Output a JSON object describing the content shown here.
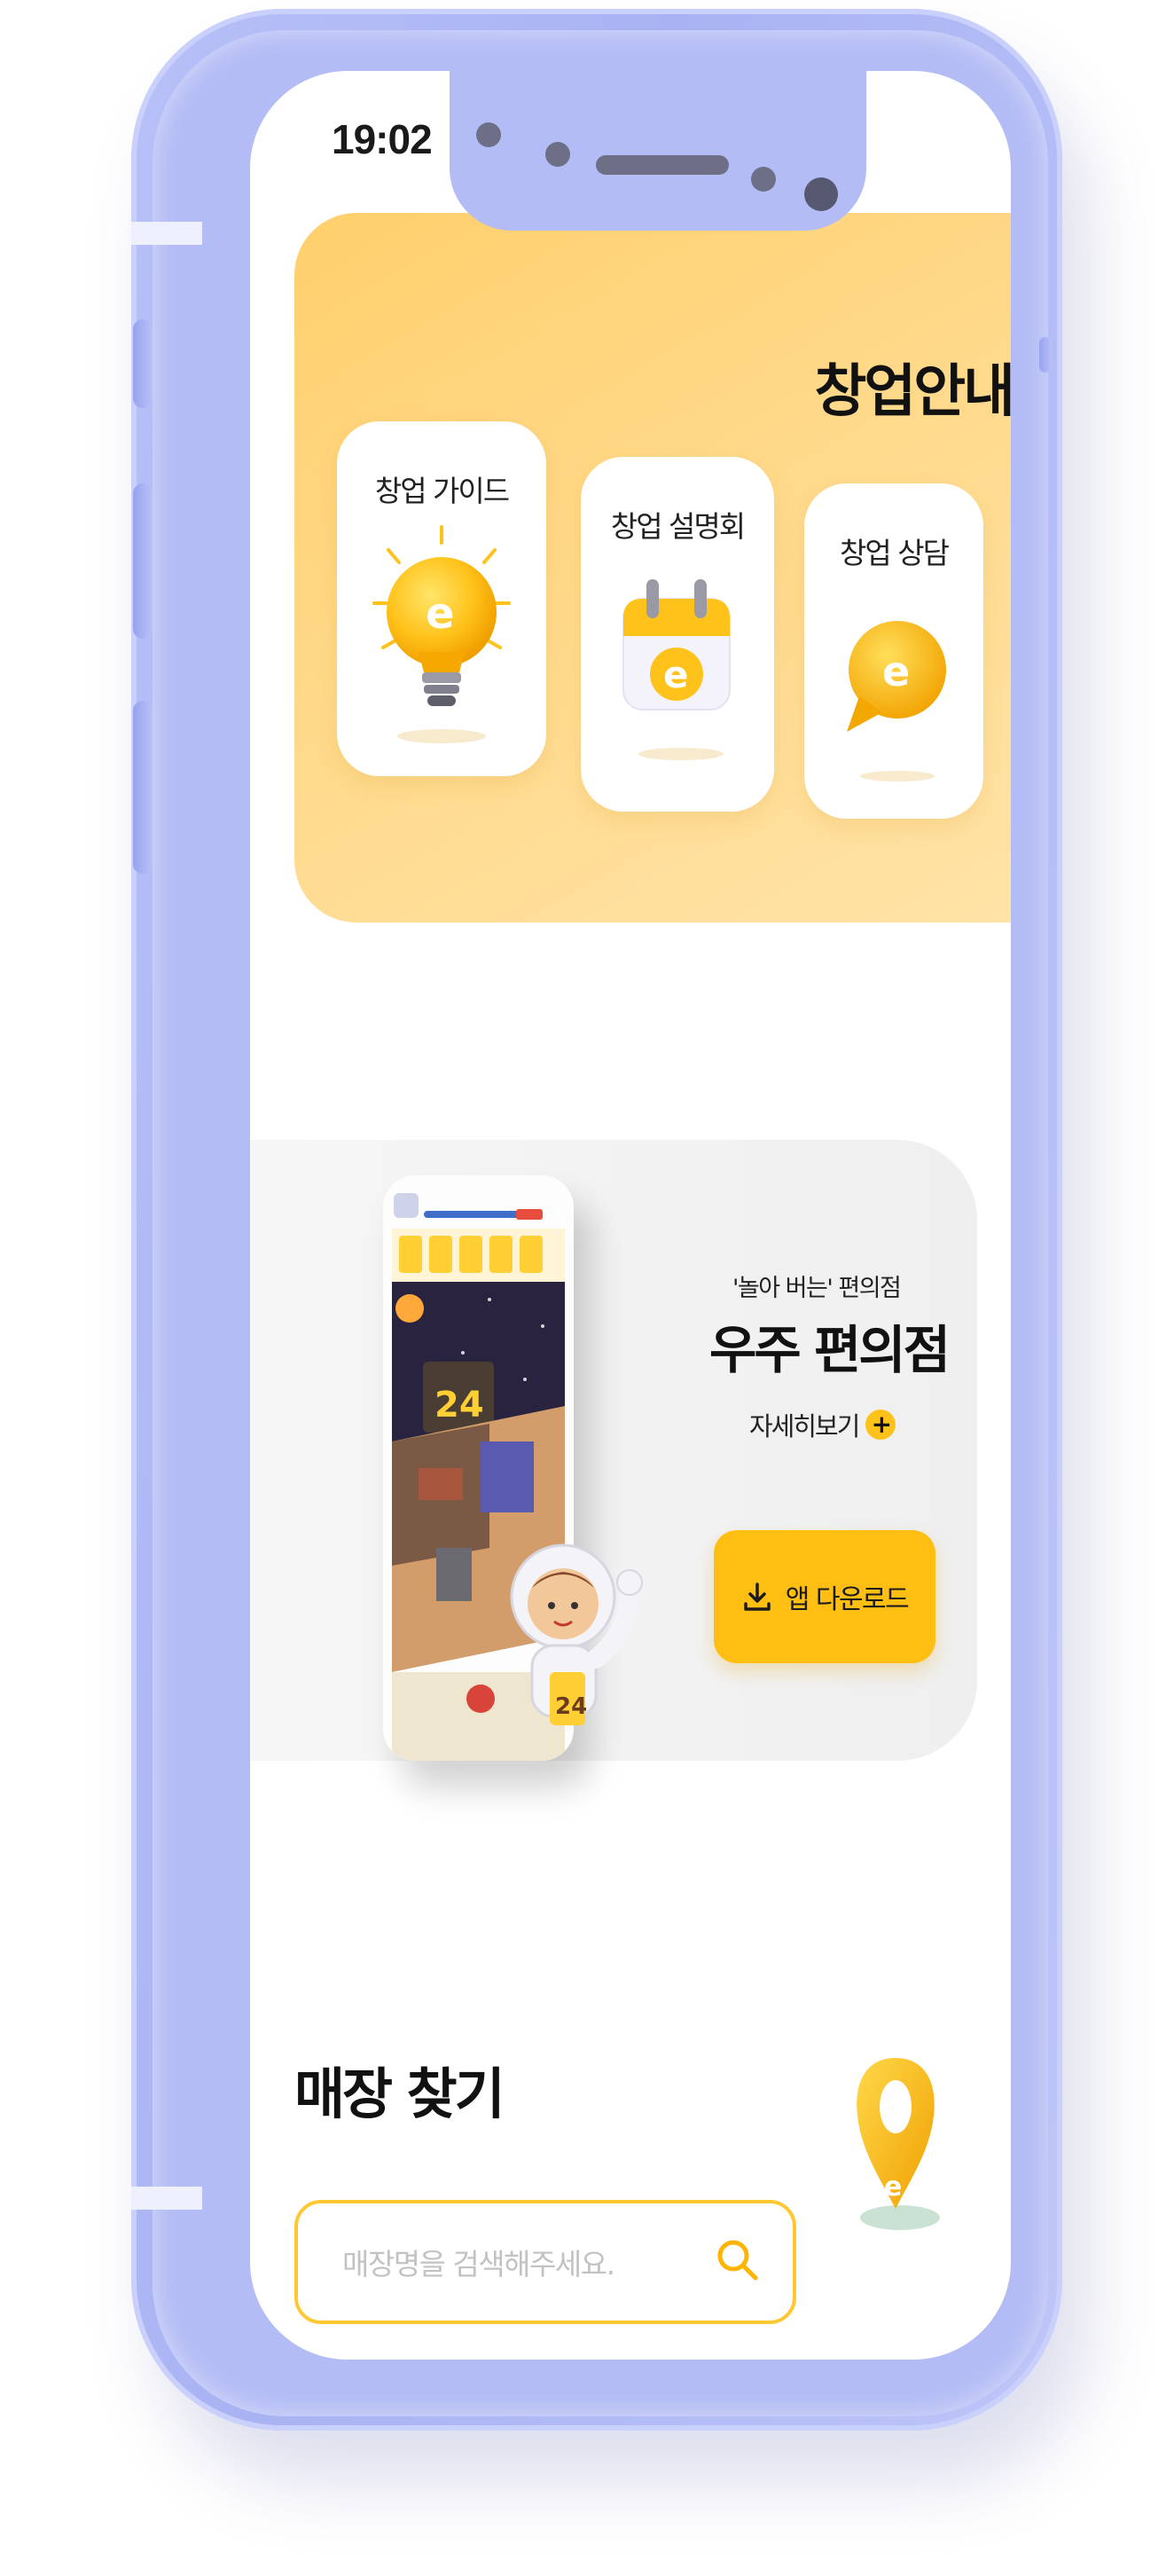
{
  "status_bar": {
    "time": "19:02"
  },
  "startup": {
    "title": "창업안내",
    "cards": [
      {
        "label": "창업 가이드",
        "icon": "lightbulb-icon"
      },
      {
        "label": "창업 설명회",
        "icon": "calendar-icon"
      },
      {
        "label": "창업 상담",
        "icon": "chat-bubble-icon"
      }
    ]
  },
  "promo": {
    "subtitle": "'놀아 버는' 편의점",
    "title": "우주 편의점",
    "more_label": "자세히보기",
    "plus": "+",
    "download_label": "앱 다운로드",
    "download_icon": "download-icon",
    "game_logo": "24"
  },
  "store_search": {
    "title": "매장 찾기",
    "placeholder": "매장명을 검색해주세요.",
    "search_icon": "search-icon",
    "pin_icon": "map-pin-icon"
  },
  "colors": {
    "phone_frame": "#b3bcf5",
    "accent_yellow": "#ffbe12",
    "startup_bg": "#ffd98a",
    "promo_bg": "#f2f2f2",
    "search_border": "#ffc832"
  }
}
